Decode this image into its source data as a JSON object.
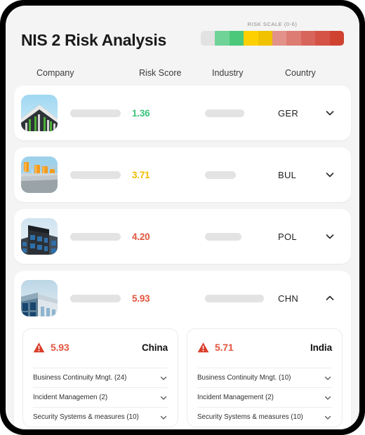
{
  "header": {
    "title": "NIS 2 Risk Analysis",
    "scale_label": "RISK SCALE (0-6)",
    "scale_colors": [
      "#e2e2e2",
      "#6fd397",
      "#4cc87a",
      "#ffd000",
      "#f0c200",
      "#e39289",
      "#dd7c72",
      "#d8655c",
      "#d55247",
      "#cf4230"
    ]
  },
  "columns": {
    "company": "Company",
    "risk_score": "Risk Score",
    "industry": "Industry",
    "country": "Country"
  },
  "rows": [
    {
      "score": "1.36",
      "score_color": "#3cc47c",
      "country": "GER",
      "thumb": "building-green-facade",
      "industry_width": 56,
      "expanded": false,
      "chevron": "chevron-down-icon"
    },
    {
      "score": "3.71",
      "score_color": "#f0bc00",
      "country": "BUL",
      "thumb": "industrial-orange-tanks",
      "industry_width": 44,
      "expanded": false,
      "chevron": "chevron-down-icon"
    },
    {
      "score": "4.20",
      "score_color": "#e2553f",
      "country": "POL",
      "thumb": "dark-modern-building",
      "industry_width": 52,
      "expanded": false,
      "chevron": "chevron-down-icon"
    },
    {
      "score": "5.93",
      "score_color": "#e2553f",
      "country": "CHN",
      "thumb": "blue-office-building",
      "industry_width": 84,
      "expanded": true,
      "chevron": "chevron-up-icon"
    }
  ],
  "detail_cards": [
    {
      "score": "5.93",
      "score_color": "#e2553f",
      "country": "China",
      "items": [
        "Business Continuity Mngt. (24)",
        "Incident Managemen (2)",
        "Security Systems & measures (10)"
      ]
    },
    {
      "score": "5.71",
      "score_color": "#e2553f",
      "country": "India",
      "items": [
        "Business Continuity Mngt.  (10)",
        "Incident Management (2)",
        "Security Systems & measures (10)"
      ]
    }
  ]
}
